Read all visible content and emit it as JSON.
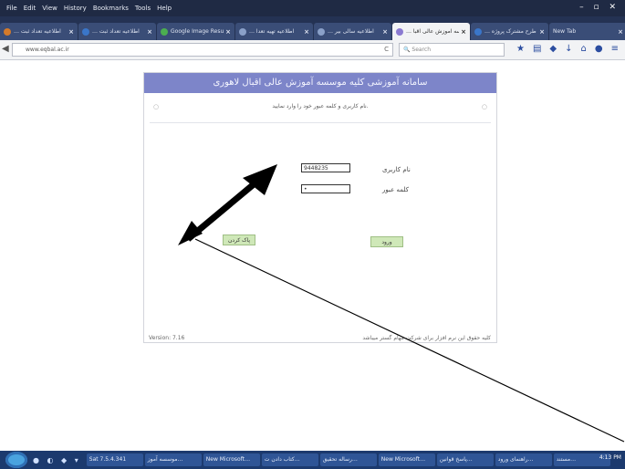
{
  "menubar": {
    "items": [
      "File",
      "Edit",
      "View",
      "History",
      "Bookmarks",
      "Tools",
      "Help"
    ]
  },
  "tabs": [
    {
      "label": "… اطلاعیه تعداد ثبت"
    },
    {
      "label": "… اطلاعیه تعداد ثبت"
    },
    {
      "label": "Google Image Result"
    },
    {
      "label": "… اطلاعیه تهیه تعدا"
    },
    {
      "label": "… اطلاعیه سالی بیر"
    },
    {
      "label": "… موسسه آموزش عالی اقبا"
    },
    {
      "label": "… طرح مشترک پروژه"
    },
    {
      "label": "New Tab"
    }
  ],
  "navbar": {
    "url": "www.eqbal.ac.ir",
    "search_placeholder": "Search"
  },
  "panel": {
    "header": "سامانه آموزشی کلیه موسسه آموزش عالی اقبال لاهوری",
    "subtitle": "نام کاربری و کلمه عبور خود را وارد نمایید.",
    "username_label": "نام کاربری",
    "username_value": "9448235",
    "password_label": "کلمه عبور",
    "password_value": "•",
    "clear_button": "پاک کردن",
    "login_button": "ورود",
    "version": "Version: 7.16",
    "copyright": "کلیه حقوق این نرم افزار برای شرکت مهام گستر میباشد"
  },
  "taskbar": {
    "items": [
      "Sat 7.5.4.341",
      "موسسه آموز…",
      "New Microsoft…",
      "کتاب دادن ت…",
      "رساله تحقیق…",
      "New Microsoft…",
      "پاسخ قوانین…",
      "راهنمای ورود…",
      "مستند…"
    ],
    "clock": "4:13 PM"
  },
  "colors": {
    "header": "#7d85c9",
    "buttons": "#cfe8b8",
    "taskbar": "#1c3a6e"
  }
}
